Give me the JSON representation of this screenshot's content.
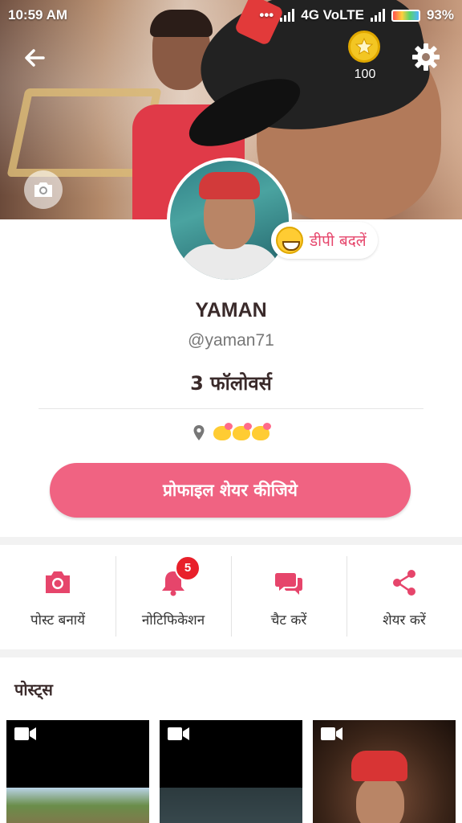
{
  "status_bar": {
    "time": "10:59 AM",
    "network": "4G VoLTE",
    "battery": "93%"
  },
  "header": {
    "coin_count": "100",
    "icons": [
      "back-arrow-icon",
      "star-coin-icon",
      "gear-icon",
      "camera-icon"
    ]
  },
  "profile": {
    "dp_change_label": "डीपी बदलें",
    "name": "YAMAN",
    "username": "@yaman71",
    "followers": "3 फॉलोवर्स",
    "share_button": "प्रोफाइल शेयर कीजिये"
  },
  "actions": [
    {
      "label": "पोस्ट बनायें",
      "icon": "camera-icon"
    },
    {
      "label": "नोटिफिकेशन",
      "icon": "bell-icon",
      "badge": "5"
    },
    {
      "label": "चैट करें",
      "icon": "chat-icon"
    },
    {
      "label": "शेयर करें",
      "icon": "share-icon"
    }
  ],
  "posts": {
    "title": "पोस्ट्स"
  },
  "colors": {
    "accent": "#f06382",
    "icon_red": "#e6456b",
    "badge_red": "#e8202a"
  }
}
